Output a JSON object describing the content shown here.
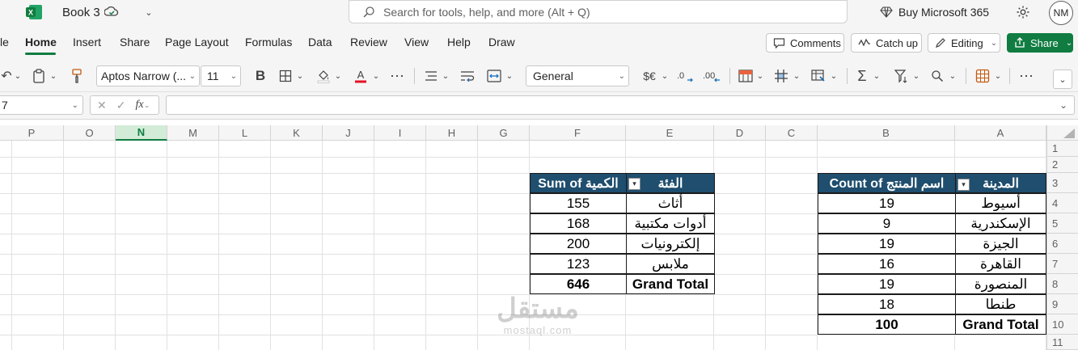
{
  "app": {
    "doc_title": "Book 3",
    "search_placeholder": "Search for tools, help, and more (Alt + Q)",
    "buy_label": "Buy Microsoft 365",
    "avatar_initials": "NM",
    "brand_color": "#107c41"
  },
  "menu": {
    "tabs": [
      "le",
      "Home",
      "Insert",
      "Share",
      "Page Layout",
      "Formulas",
      "Data",
      "Review",
      "View",
      "Help",
      "Draw"
    ],
    "active_tab": "Home",
    "comments_label": "Comments",
    "catchup_label": "Catch up",
    "editing_label": "Editing",
    "share_label": "Share"
  },
  "ribbon": {
    "font_name": "Aptos Narrow (...",
    "font_size": "11",
    "number_format": "General",
    "currency_label": "$€"
  },
  "formula_bar": {
    "name_box": "7",
    "fx_label": "fx",
    "formula_value": ""
  },
  "grid": {
    "columns": [
      "P",
      "O",
      "N",
      "M",
      "L",
      "K",
      "J",
      "I",
      "H",
      "G",
      "F",
      "E",
      "D",
      "C",
      "B",
      "A"
    ],
    "selected_column": "N",
    "rows": [
      "1",
      "2",
      "3",
      "4",
      "5",
      "6",
      "7",
      "8",
      "9",
      "10",
      "11"
    ]
  },
  "pivot_city": {
    "header_label": "المدينة",
    "header_value": "Count of اسم المنتج",
    "rows": [
      {
        "label": "أسيوط",
        "value": "19"
      },
      {
        "label": "الإسكندرية",
        "value": "9"
      },
      {
        "label": "الجيزة",
        "value": "19"
      },
      {
        "label": "القاهرة",
        "value": "16"
      },
      {
        "label": "المنصورة",
        "value": "19"
      },
      {
        "label": "طنطا",
        "value": "18"
      }
    ],
    "total_label": "Grand Total",
    "total_value": "100"
  },
  "pivot_category": {
    "header_label": "الفئة",
    "header_value": "Sum of الكمية",
    "rows": [
      {
        "label": "أثاث",
        "value": "155"
      },
      {
        "label": "أدوات مكتبية",
        "value": "168"
      },
      {
        "label": "إلكترونيات",
        "value": "200"
      },
      {
        "label": "ملابس",
        "value": "123"
      }
    ],
    "total_label": "Grand Total",
    "total_value": "646"
  },
  "watermark": {
    "arabic": "مستقل",
    "latin": "mostaql.com"
  }
}
